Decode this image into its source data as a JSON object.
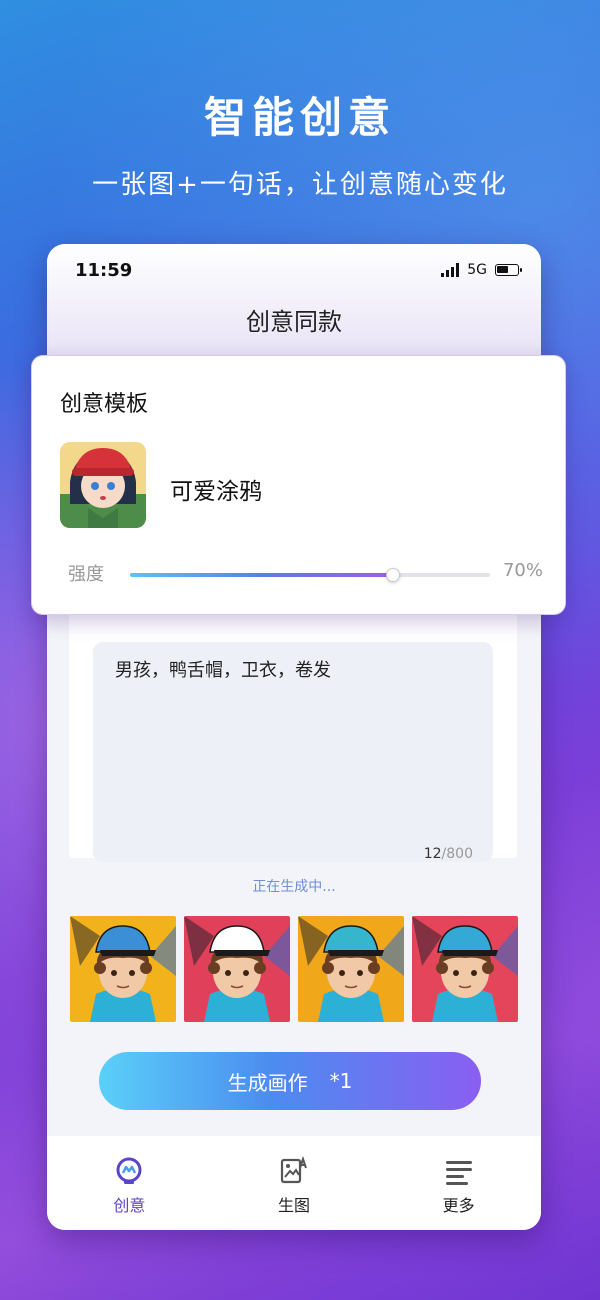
{
  "promo": {
    "headline": "智能创意",
    "subline": "一张图+一句话，让创意随心变化"
  },
  "status_bar": {
    "time": "11:59",
    "network": "5G"
  },
  "page": {
    "title": "创意同款"
  },
  "template_card": {
    "title": "创意模板",
    "template_name": "可爱涂鸦",
    "strength_label": "强度",
    "strength_value": "70%",
    "strength_fraction": 0.73
  },
  "prompt": {
    "text": "男孩，鸭舌帽，卫衣，卷发",
    "count_current": "12",
    "count_max": "/800"
  },
  "generation": {
    "status": "正在生成中...",
    "results": [
      {
        "name": "result-1",
        "cap_color": "#3a8fd6",
        "bg": "#f2b21c"
      },
      {
        "name": "result-2",
        "cap_color": "#ffffff",
        "bg": "#e0405a"
      },
      {
        "name": "result-3",
        "cap_color": "#36b6cc",
        "bg": "#f0a81a"
      },
      {
        "name": "result-4",
        "cap_color": "#35a9d6",
        "bg": "#e5455a"
      }
    ],
    "button_label": "生成画作",
    "button_cost": "*1"
  },
  "tabbar": {
    "items": [
      {
        "label": "创意",
        "icon": "creative-icon",
        "active": true
      },
      {
        "label": "生图",
        "icon": "image-generate-icon",
        "active": false
      },
      {
        "label": "更多",
        "icon": "menu-lines-icon",
        "active": false
      }
    ]
  },
  "colors": {
    "accent": "#5a45c8",
    "status_text": "#6f8fd6"
  }
}
